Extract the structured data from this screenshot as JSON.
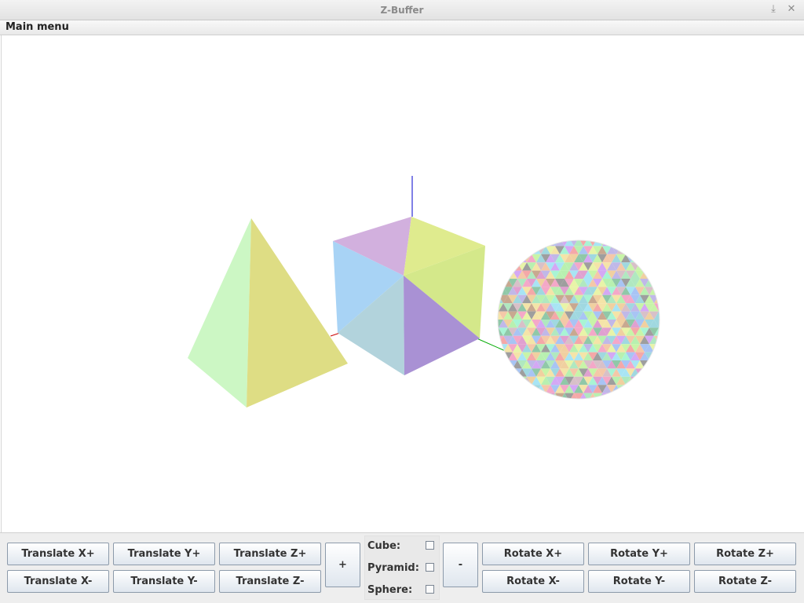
{
  "window": {
    "title": "Z-Buffer",
    "minimize_glyph": "⤓",
    "close_glyph": "✕"
  },
  "menubar": {
    "main_menu": "Main menu"
  },
  "scene": {
    "objects": [
      "pyramid",
      "cube",
      "sphere"
    ],
    "axis_colors": {
      "x": "#cc0000",
      "y": "#00aa00",
      "z": "#0000cc"
    },
    "face_colors": [
      "#ccf7c4",
      "#dedd84",
      "#d2b0de",
      "#dfeb8e",
      "#a8d3f5",
      "#d4e88a",
      "#b2d3dc",
      "#a991d4"
    ]
  },
  "controls": {
    "translate": {
      "x_plus": "Translate X+",
      "y_plus": "Translate Y+",
      "z_plus": "Translate Z+",
      "x_minus": "Translate X-",
      "y_minus": "Translate Y-",
      "z_minus": "Translate Z-"
    },
    "plus": "+",
    "minus": "-",
    "checks": {
      "cube": {
        "label": "Cube:",
        "checked": false
      },
      "pyramid": {
        "label": "Pyramid:",
        "checked": false
      },
      "sphere": {
        "label": "Sphere:",
        "checked": false
      }
    },
    "rotate": {
      "x_plus": "Rotate X+",
      "y_plus": "Rotate Y+",
      "z_plus": "Rotate Z+",
      "x_minus": "Rotate X-",
      "y_minus": "Rotate Y-",
      "z_minus": "Rotate Z-"
    }
  }
}
